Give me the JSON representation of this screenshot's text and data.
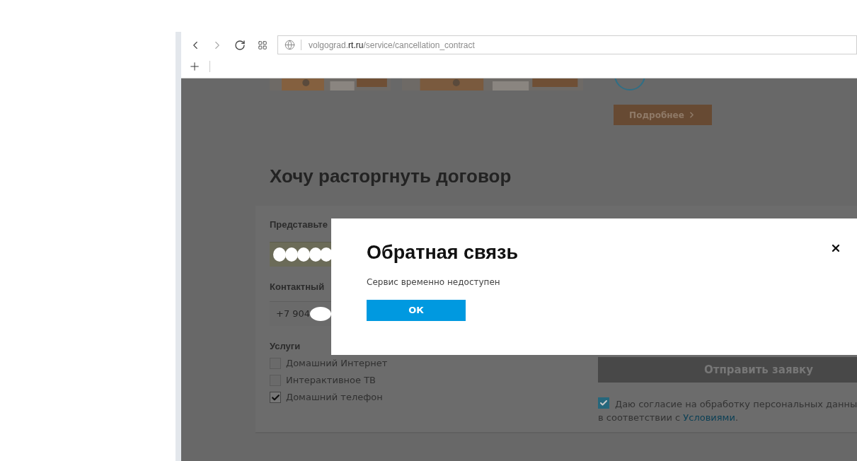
{
  "browser": {
    "url": [
      {
        "text": "volgograd.",
        "kind": "dim"
      },
      {
        "text": "rt.ru",
        "kind": "strong"
      },
      {
        "text": "/service/cancellation_contract",
        "kind": "dim"
      }
    ]
  },
  "page": {
    "promo_button": "Подробнее",
    "heading": "Хочу расторгнуть договор",
    "form": {
      "name_label": "Представьте",
      "phone_label": "Контактный",
      "phone_value": "+7 904",
      "services_label": "Услуги",
      "services": [
        {
          "label": "Домашний Интернет",
          "checked": false
        },
        {
          "label": "Интерактивное ТВ",
          "checked": false
        },
        {
          "label": "Домашний телефон",
          "checked": true
        }
      ],
      "submit": "Отправить заявку",
      "consent": {
        "checked": true,
        "text": "Даю согласие на обработку персональных данны",
        "text2": "в соответствии с ",
        "link": "Условиями",
        "tail": "."
      }
    }
  },
  "modal": {
    "title": "Обратная связь",
    "message": "Сервис временно недоступен",
    "ok": "ОК"
  }
}
